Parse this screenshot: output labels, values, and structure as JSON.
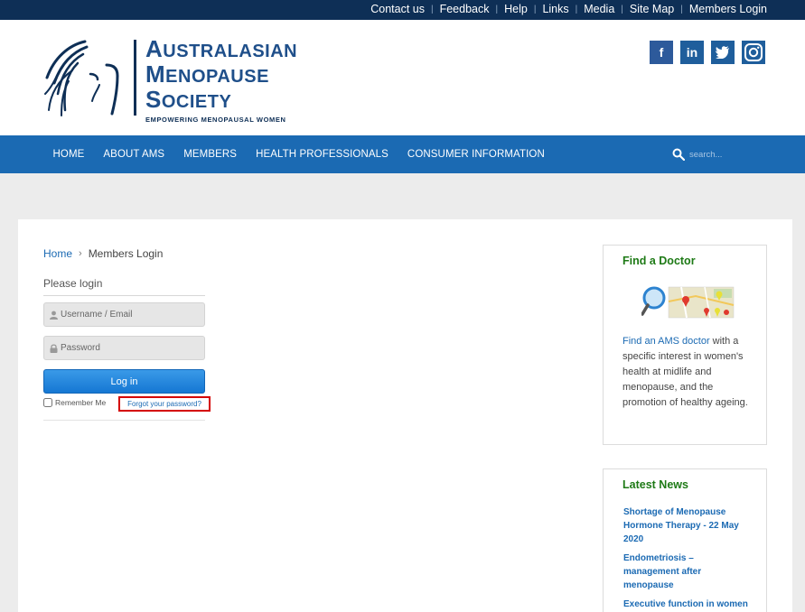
{
  "topnav": {
    "items": [
      "Contact us",
      "Feedback",
      "Help",
      "Links",
      "Media",
      "Site Map",
      "Members Login"
    ]
  },
  "logo": {
    "line1_cap": "A",
    "line1_rest": "USTRALASIAN",
    "line2_cap": "M",
    "line2_rest": "ENOPAUSE",
    "line3_cap": "S",
    "line3_rest": "OCIETY",
    "tagline": "EMPOWERING MENOPAUSAL WOMEN"
  },
  "social": {
    "facebook": "f",
    "linkedin": "in",
    "twitter": "t",
    "instagram": "instagram-icon"
  },
  "mainnav": {
    "items": [
      "HOME",
      "ABOUT AMS",
      "MEMBERS",
      "HEALTH PROFESSIONALS",
      "CONSUMER INFORMATION"
    ],
    "search_placeholder": "search..."
  },
  "breadcrumb": {
    "home": "Home",
    "current": "Members Login"
  },
  "login": {
    "title": "Please login",
    "username_placeholder": "Username / Email",
    "password_placeholder": "Password",
    "button": "Log in",
    "remember": "Remember Me",
    "forgot": "Forgot your password?"
  },
  "find_doctor": {
    "title": "Find a Doctor",
    "link_text": "Find an AMS doctor",
    "body": " with a specific interest in women's health at midlife and menopause, and the promotion of healthy ageing."
  },
  "latest_news": {
    "title": "Latest News",
    "items": [
      "Shortage of Menopause Hormone Therapy - 22 May 2020",
      "Endometriosis – management after menopause",
      "Executive function in women"
    ]
  },
  "colors": {
    "topbar": "#0e2f56",
    "nav": "#1b6ab3",
    "green_heading": "#1e7a16",
    "link": "#1b6ab3",
    "highlight": "#d40000"
  }
}
